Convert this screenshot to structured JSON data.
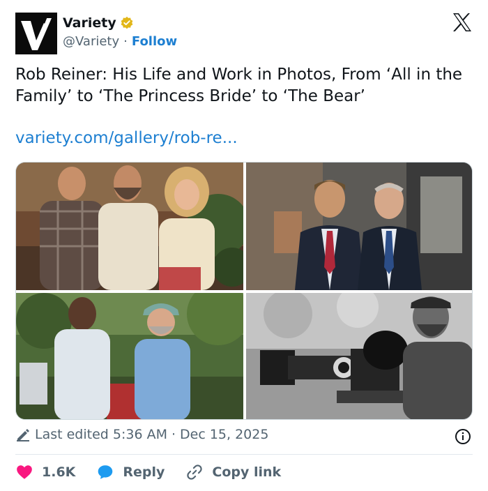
{
  "author": {
    "name": "Variety",
    "handle": "@Variety",
    "separator": "·",
    "follow_label": "Follow",
    "avatar_icon": "variety-v-logo",
    "verified_icon": "verified-badge-icon"
  },
  "brand": {
    "logo_icon": "x-logo-icon"
  },
  "tweet": {
    "text": "Rob Reiner: His Life and Work in Photos, From ‘All in the Family’ to ‘The Princess Bride’ to ‘The Bear’",
    "link": "variety.com/gallery/rob-re..."
  },
  "gallery": {
    "photos": [
      "photo-1",
      "photo-2",
      "photo-3",
      "photo-4"
    ]
  },
  "meta": {
    "edited_label": "Last edited 5:36 AM",
    "separator": "·",
    "date": "Dec 15, 2025"
  },
  "actions": {
    "like_count": "1.6K",
    "reply_label": "Reply",
    "copy_label": "Copy link"
  },
  "colors": {
    "link": "#1d7fd1",
    "like": "#f91880",
    "reply": "#1d9bf0",
    "verified": "#e2b719",
    "muted": "#536471"
  }
}
